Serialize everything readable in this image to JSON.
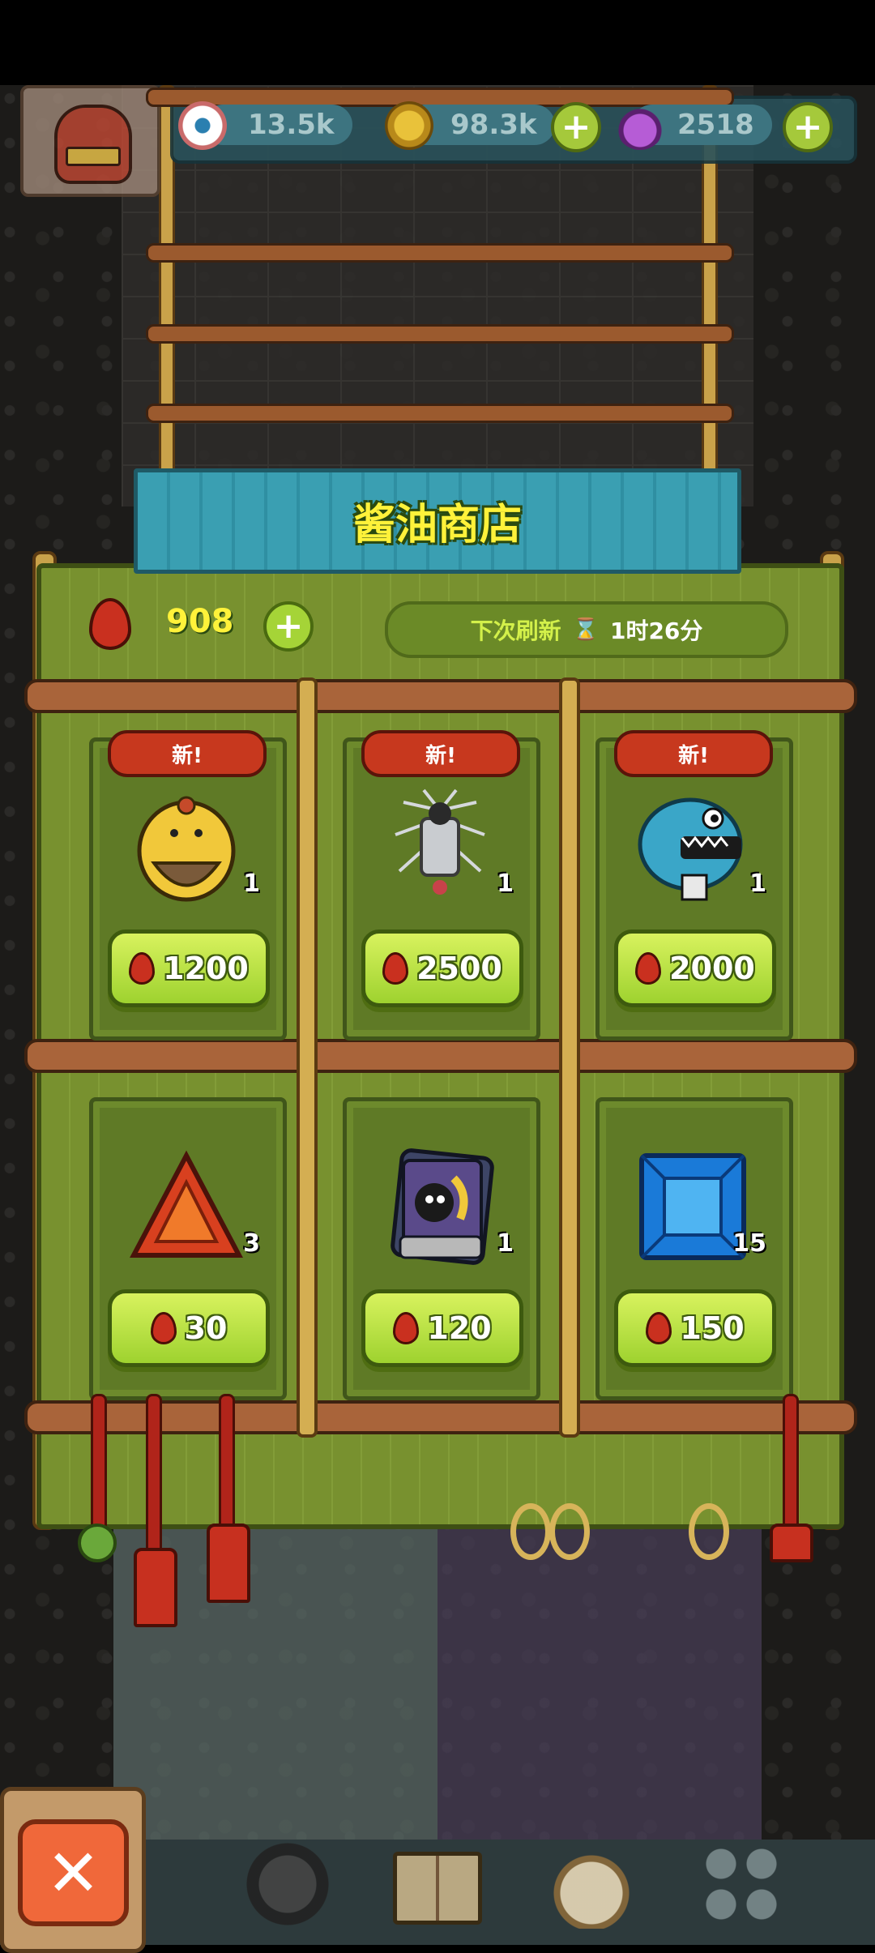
{
  "hud": {
    "eyeballs": "13.5k",
    "coins": "98.3k",
    "potions": "2518"
  },
  "shop": {
    "title": "酱油商店",
    "balance": "908",
    "refresh_label": "下次刷新",
    "refresh_time": "1时26分"
  },
  "items": [
    {
      "tag": "新!",
      "qty": "1",
      "price": "1200",
      "icon": "yellow-monster-icon"
    },
    {
      "tag": "新!",
      "qty": "1",
      "price": "2500",
      "icon": "spiky-ghost-monster-icon"
    },
    {
      "tag": "新!",
      "qty": "1",
      "price": "2000",
      "icon": "blue-fish-monster-icon"
    },
    {
      "qty": "3",
      "price": "30",
      "icon": "red-triangle-gem-icon"
    },
    {
      "qty": "1",
      "price": "120",
      "icon": "card-pack-icon"
    },
    {
      "qty": "15",
      "price": "150",
      "icon": "blue-square-gem-icon"
    }
  ],
  "close_label": "✕"
}
